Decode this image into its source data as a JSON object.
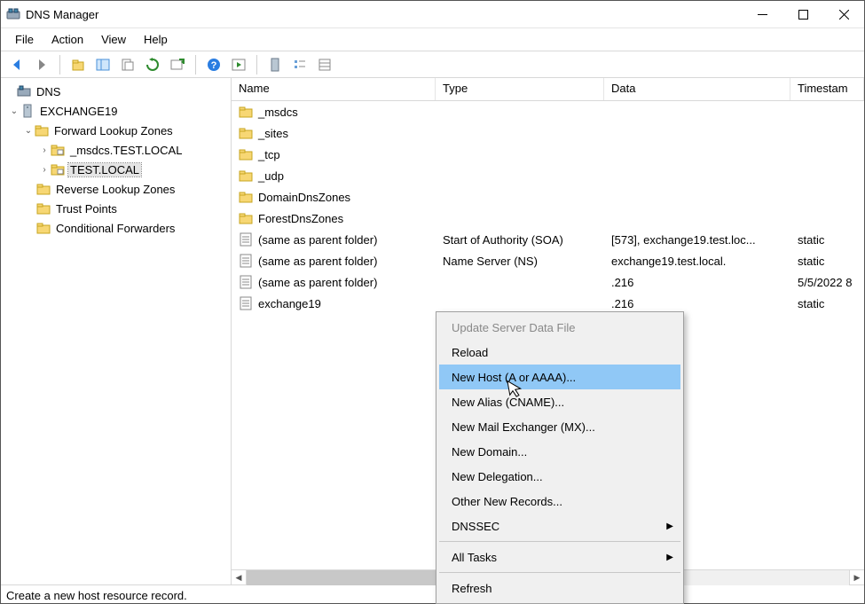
{
  "window": {
    "title": "DNS Manager"
  },
  "menubar": {
    "file": "File",
    "action": "Action",
    "view": "View",
    "help": "Help"
  },
  "toolbar_icons": [
    "back",
    "forward",
    "up",
    "frame",
    "export",
    "refresh",
    "new-window",
    "help",
    "play",
    "props",
    "list",
    "details"
  ],
  "tree": {
    "root": "DNS",
    "server": "EXCHANGE19",
    "flz": "Forward Lookup Zones",
    "msdcs": "_msdcs.TEST.LOCAL",
    "testlocal": "TEST.LOCAL",
    "rlz": "Reverse Lookup Zones",
    "trust": "Trust Points",
    "cond": "Conditional Forwarders"
  },
  "columns": {
    "name": "Name",
    "type": "Type",
    "data": "Data",
    "ts": "Timestam"
  },
  "rows": [
    {
      "icon": "folder",
      "name": "_msdcs",
      "type": "",
      "data": "",
      "ts": ""
    },
    {
      "icon": "folder",
      "name": "_sites",
      "type": "",
      "data": "",
      "ts": ""
    },
    {
      "icon": "folder",
      "name": "_tcp",
      "type": "",
      "data": "",
      "ts": ""
    },
    {
      "icon": "folder",
      "name": "_udp",
      "type": "",
      "data": "",
      "ts": ""
    },
    {
      "icon": "folder",
      "name": "DomainDnsZones",
      "type": "",
      "data": "",
      "ts": ""
    },
    {
      "icon": "folder",
      "name": "ForestDnsZones",
      "type": "",
      "data": "",
      "ts": ""
    },
    {
      "icon": "record",
      "name": "(same as parent folder)",
      "type": "Start of Authority (SOA)",
      "data": "[573], exchange19.test.loc...",
      "ts": "static"
    },
    {
      "icon": "record",
      "name": "(same as parent folder)",
      "type": "Name Server (NS)",
      "data": "exchange19.test.local.",
      "ts": "static"
    },
    {
      "icon": "record",
      "name": "(same as parent folder)",
      "type": "",
      "data": ".216",
      "ts": "5/5/2022 8"
    },
    {
      "icon": "record",
      "name": "exchange19",
      "type": "",
      "data": ".216",
      "ts": "static"
    }
  ],
  "context_menu": {
    "update": "Update Server Data File",
    "reload": "Reload",
    "new_host": "New Host (A or AAAA)...",
    "new_alias": "New Alias (CNAME)...",
    "new_mx": "New Mail Exchanger (MX)...",
    "new_domain": "New Domain...",
    "new_deleg": "New Delegation...",
    "other": "Other New Records...",
    "dnssec": "DNSSEC",
    "all_tasks": "All Tasks",
    "refresh": "Refresh"
  },
  "statusbar": {
    "text": "Create a new host resource record."
  }
}
